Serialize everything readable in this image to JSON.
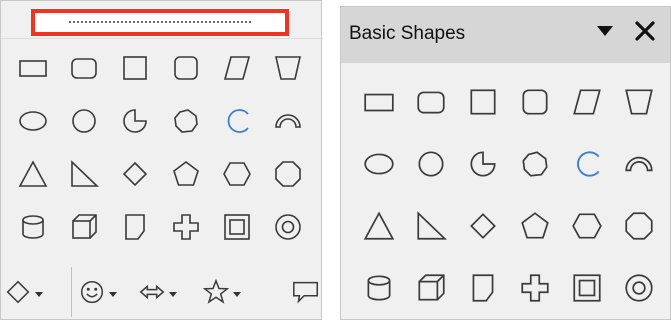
{
  "left_toolbar": {
    "shapes": [
      {
        "icon": "rectangle-icon"
      },
      {
        "icon": "rounded-rectangle-icon"
      },
      {
        "icon": "square-icon"
      },
      {
        "icon": "rounded-square-icon"
      },
      {
        "icon": "parallelogram-icon"
      },
      {
        "icon": "trapezoid-icon"
      },
      {
        "icon": "ellipse-icon"
      },
      {
        "icon": "circle-icon"
      },
      {
        "icon": "circle-pie-icon"
      },
      {
        "icon": "block-arc-icon"
      },
      {
        "icon": "arc-icon"
      },
      {
        "icon": "semicircle-arc-icon"
      },
      {
        "icon": "isosceles-triangle-icon"
      },
      {
        "icon": "right-triangle-icon"
      },
      {
        "icon": "diamond-icon"
      },
      {
        "icon": "pentagon-icon"
      },
      {
        "icon": "hexagon-icon"
      },
      {
        "icon": "octagon-icon"
      },
      {
        "icon": "cylinder-icon"
      },
      {
        "icon": "cube-icon"
      },
      {
        "icon": "folded-corner-icon"
      },
      {
        "icon": "cross-icon"
      },
      {
        "icon": "frame-icon"
      },
      {
        "icon": "ring-icon"
      }
    ],
    "dropdowns": [
      {
        "icon": "basic-shapes-diamond-icon"
      },
      {
        "icon": "smiley-icon"
      },
      {
        "icon": "double-arrow-icon"
      },
      {
        "icon": "star-icon"
      },
      {
        "icon": "callout-icon"
      }
    ]
  },
  "right_panel": {
    "title": "Basic Shapes",
    "menu_icon": "dropdown-triangle-icon",
    "close_icon": "close-icon"
  },
  "colors": {
    "highlight": "#ee3524",
    "arc_blue": "#3a7fd6",
    "panel_bg": "#f0f0f0",
    "titlebar_bg": "#d6d6d6"
  }
}
